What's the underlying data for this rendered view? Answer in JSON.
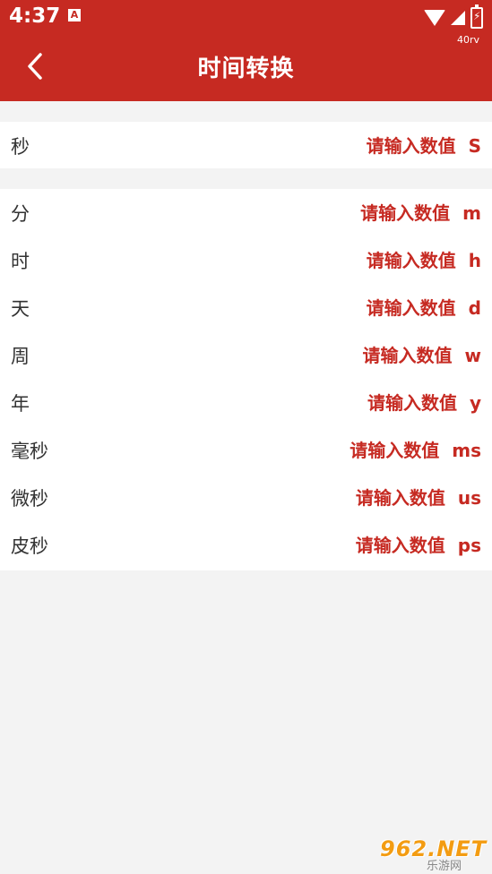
{
  "status_bar": {
    "time": "4:37",
    "speed_badge": "40rv"
  },
  "header": {
    "title": "时间转换",
    "background_color": "#c62a22"
  },
  "units_primary": [
    {
      "label": "秒",
      "placeholder": "请输入数值",
      "unit": "S"
    }
  ],
  "units_secondary": [
    {
      "label": "分",
      "placeholder": "请输入数值",
      "unit": "m"
    },
    {
      "label": "时",
      "placeholder": "请输入数值",
      "unit": "h"
    },
    {
      "label": "天",
      "placeholder": "请输入数值",
      "unit": "d"
    },
    {
      "label": "周",
      "placeholder": "请输入数值",
      "unit": "w"
    },
    {
      "label": "年",
      "placeholder": "请输入数值",
      "unit": "y"
    },
    {
      "label": "毫秒",
      "placeholder": "请输入数值",
      "unit": "ms"
    },
    {
      "label": "微秒",
      "placeholder": "请输入数值",
      "unit": "us"
    },
    {
      "label": "皮秒",
      "placeholder": "请输入数值",
      "unit": "ps"
    }
  ],
  "watermark": {
    "brand": "962.NET",
    "subtitle": "乐游网"
  },
  "accent_color": "#c62a22"
}
